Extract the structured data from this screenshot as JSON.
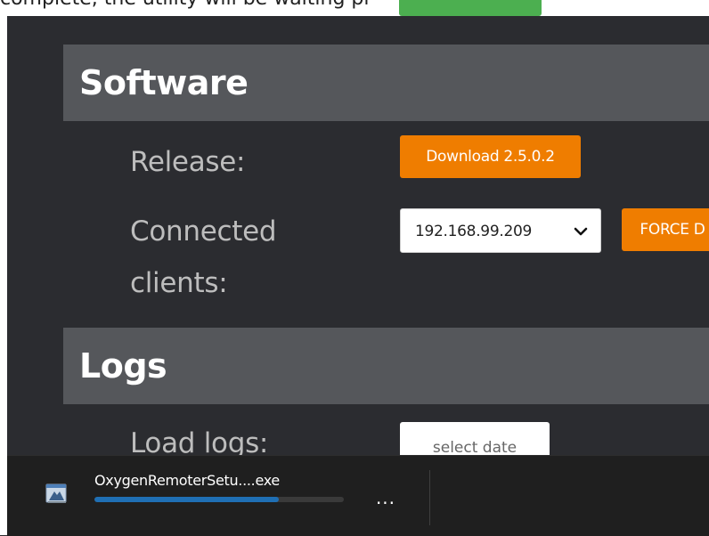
{
  "top_partial": {
    "text": "complete, the utility will be waiting pi"
  },
  "software": {
    "title": "Software",
    "release_label": "Release:",
    "download_button": "Download 2.5.0.2",
    "clients_label_line1": "Connected",
    "clients_label_line2": "clients:",
    "clients_select_value": "192.168.99.209",
    "force_button": "FORCE D"
  },
  "logs": {
    "title": "Logs",
    "load_label": "Load logs:",
    "date_button": "select date"
  },
  "download_bar": {
    "file_name": "OxygenRemoterSetu....exe",
    "progress_fraction": 0.74,
    "more_label": "...",
    "progress_color": "#1f6fb4"
  },
  "colors": {
    "accent_orange": "#ef7d00",
    "section_header_bg": "#55575b",
    "page_bg": "#2b2c30"
  }
}
